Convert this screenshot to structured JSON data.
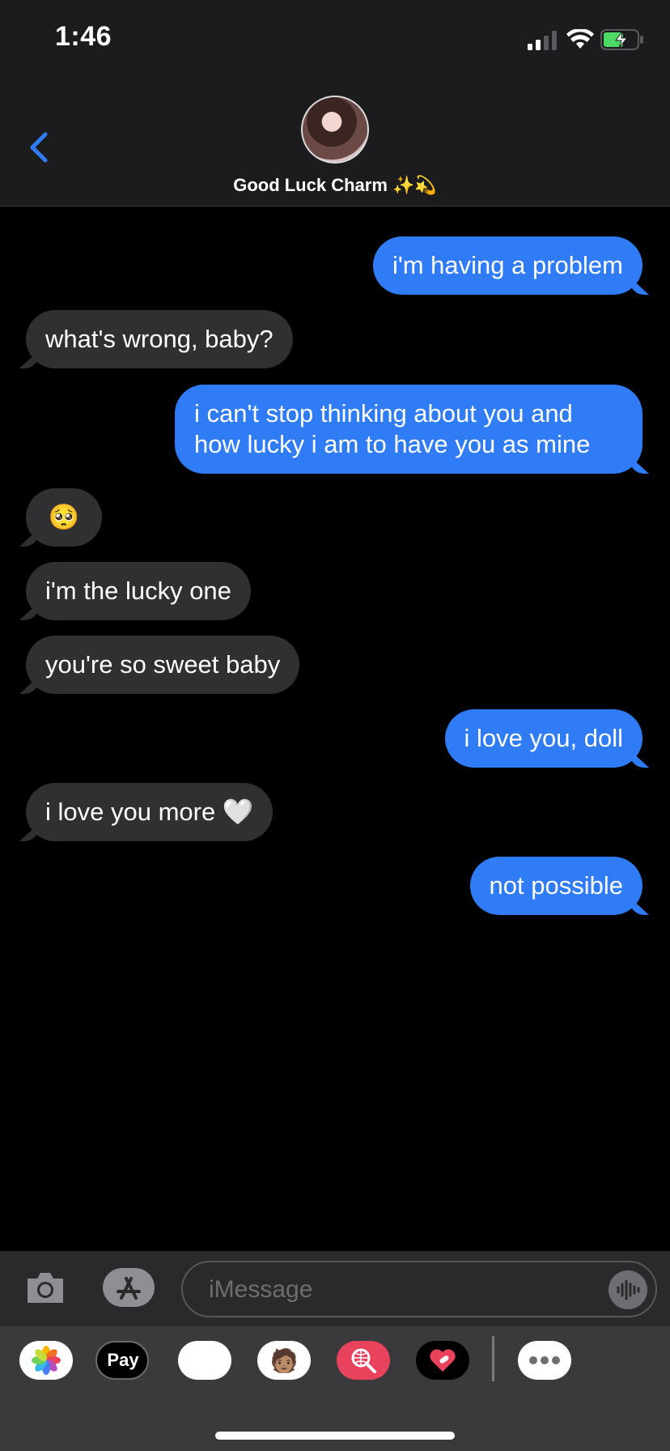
{
  "status_bar": {
    "time": "1:46"
  },
  "header": {
    "contact_name": "Good Luck Charm ✨💫"
  },
  "messages": [
    {
      "from": "me",
      "text": "i'm having a problem"
    },
    {
      "from": "them",
      "text": "what's wrong, baby?"
    },
    {
      "from": "me",
      "text": "i can't stop thinking about you and how lucky i am to have you as mine"
    },
    {
      "from": "them",
      "text": "🥺"
    },
    {
      "from": "them",
      "text": "i'm the lucky one"
    },
    {
      "from": "them",
      "text": "you're so sweet baby"
    },
    {
      "from": "me",
      "text": "i love you, doll"
    },
    {
      "from": "them",
      "text": "i love you more 🤍"
    },
    {
      "from": "me",
      "text": "not possible"
    }
  ],
  "input": {
    "placeholder": "iMessage"
  },
  "drawer": {
    "apple_pay_label": "Pay",
    "apps": [
      "photos-icon",
      "apple-pay-icon",
      "animoji-icon",
      "memoji-icon",
      "image-search-icon",
      "heart-sticker-icon",
      "more-icon"
    ]
  },
  "colors": {
    "sent_bubble": "#2f7cf6",
    "received_bubble": "#303033",
    "accent": "#2f7cf6"
  }
}
